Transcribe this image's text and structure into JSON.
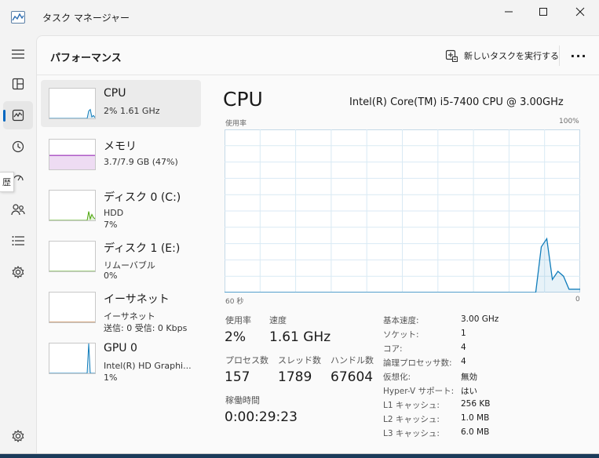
{
  "window": {
    "title": "タスク マネージャー"
  },
  "page": {
    "title": "パフォーマンス",
    "run_task_label": "新しいタスクを実行する",
    "more_label": "···"
  },
  "rail": {
    "items": [
      {
        "icon": "hamburger-menu-icon"
      },
      {
        "icon": "processes-icon"
      },
      {
        "icon": "performance-icon",
        "active": true
      },
      {
        "icon": "app-history-icon"
      },
      {
        "icon": "startup-apps-icon"
      },
      {
        "icon": "users-icon"
      },
      {
        "icon": "details-icon"
      },
      {
        "icon": "services-icon"
      },
      {
        "icon": "settings-icon"
      }
    ],
    "tooltip_fragment": "歴"
  },
  "devices": [
    {
      "name": "CPU",
      "lines": [
        "2%  1.61 GHz"
      ],
      "color": "#117dbb",
      "spark": [
        0,
        0,
        0,
        0,
        0,
        0,
        0,
        0,
        0,
        0,
        0,
        0,
        0,
        0,
        0,
        0,
        0,
        0,
        0,
        0,
        0,
        0,
        0,
        0,
        0,
        25,
        30,
        5,
        10,
        3
      ]
    },
    {
      "name": "メモリ",
      "lines": [
        "3.7/7.9 GB (47%)"
      ],
      "color": "#8b12ae",
      "spark": [
        47,
        47,
        47,
        47,
        47,
        47,
        47,
        47,
        47,
        47,
        47,
        47,
        47,
        47,
        47,
        47,
        47,
        47,
        47,
        47,
        47,
        47,
        47,
        47,
        47,
        47,
        47,
        47,
        47,
        47
      ]
    },
    {
      "name": "ディスク 0 (C:)",
      "lines": [
        "HDD",
        "7%"
      ],
      "color": "#4da60c",
      "spark": [
        0,
        0,
        0,
        0,
        0,
        0,
        0,
        0,
        0,
        0,
        0,
        0,
        0,
        0,
        0,
        0,
        0,
        0,
        0,
        0,
        0,
        0,
        0,
        0,
        0,
        30,
        5,
        20,
        10,
        5
      ]
    },
    {
      "name": "ディスク 1 (E:)",
      "lines": [
        "リムーバブル",
        "0%"
      ],
      "color": "#4da60c",
      "spark": [
        0,
        0,
        0,
        0,
        0,
        0,
        0,
        0,
        0,
        0,
        0,
        0,
        0,
        0,
        0,
        0,
        0,
        0,
        0,
        0,
        0,
        0,
        0,
        0,
        0,
        0,
        0,
        0,
        0,
        0
      ]
    },
    {
      "name": "イーサネット",
      "lines": [
        "イーサネット",
        "送信: 0 受信: 0 Kbps"
      ],
      "color": "#a74f01",
      "spark": [
        0,
        0,
        0,
        0,
        0,
        0,
        0,
        0,
        0,
        0,
        0,
        0,
        0,
        0,
        0,
        0,
        0,
        0,
        0,
        0,
        0,
        0,
        0,
        0,
        0,
        0,
        0,
        0,
        0,
        0
      ]
    },
    {
      "name": "GPU 0",
      "lines": [
        "Intel(R) HD Graphi...",
        "1%"
      ],
      "color": "#117dbb",
      "spark": [
        0,
        0,
        0,
        0,
        0,
        0,
        0,
        0,
        0,
        0,
        0,
        0,
        0,
        0,
        0,
        0,
        0,
        0,
        0,
        0,
        0,
        0,
        0,
        0,
        0,
        100,
        0,
        0,
        0,
        0
      ]
    }
  ],
  "detail": {
    "title": "CPU",
    "model": "Intel(R) Core(TM) i5-7400 CPU @ 3.00GHz",
    "graph": {
      "top_left_label": "使用率",
      "top_right_label": "100%",
      "bottom_left_label": "60 秒",
      "bottom_right_label": "0",
      "line_color": "#117dbb",
      "fill_color": "#f1f6fa",
      "grid_color": "#d9eaf4"
    },
    "stats": {
      "usage_label": "使用率",
      "usage_value": "2%",
      "speed_label": "速度",
      "speed_value": "1.61 GHz",
      "processes_label": "プロセス数",
      "processes_value": "157",
      "threads_label": "スレッド数",
      "threads_value": "1789",
      "handles_label": "ハンドル数",
      "handles_value": "67604",
      "uptime_label": "稼働時間",
      "uptime_value": "0:00:29:23"
    },
    "specs": [
      {
        "label": "基本速度:",
        "value": "3.00 GHz"
      },
      {
        "label": "ソケット:",
        "value": "1"
      },
      {
        "label": "コア:",
        "value": "4"
      },
      {
        "label": "論理プロセッサ数:",
        "value": "4"
      },
      {
        "label": "仮想化:",
        "value": "無効"
      },
      {
        "label": "Hyper-V サポート:",
        "value": "はい"
      },
      {
        "label": "L1 キャッシュ:",
        "value": "256 KB"
      },
      {
        "label": "L2 キャッシュ:",
        "value": "1.0 MB"
      },
      {
        "label": "L3 キャッシュ:",
        "value": "6.0 MB"
      }
    ],
    "usage_history": [
      0,
      0,
      0,
      0,
      0,
      0,
      0,
      0,
      0,
      0,
      0,
      0,
      0,
      0,
      0,
      0,
      0,
      0,
      0,
      0,
      0,
      0,
      0,
      0,
      0,
      0,
      0,
      0,
      0,
      0,
      0,
      0,
      0,
      0,
      0,
      0,
      0,
      0,
      0,
      0,
      0,
      0,
      0,
      0,
      0,
      0,
      0,
      0,
      0,
      0,
      0,
      0,
      0,
      0,
      0,
      0,
      0,
      28,
      33,
      8,
      13,
      10,
      2,
      2,
      2
    ]
  }
}
